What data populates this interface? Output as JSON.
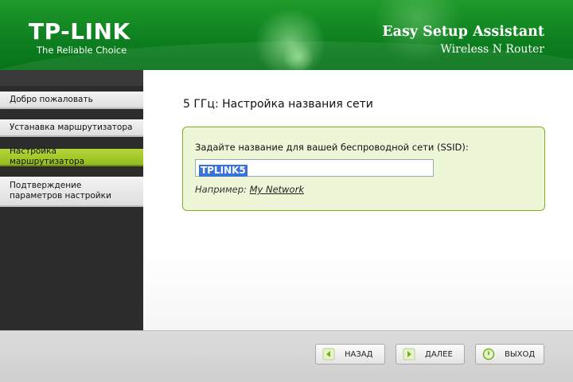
{
  "header": {
    "logo": "TP-LINK",
    "tagline": "The Reliable Choice",
    "title": "Easy Setup Assistant",
    "subtitle": "Wireless N Router"
  },
  "sidebar": {
    "items": [
      {
        "label": "Добро пожаловать",
        "active": false
      },
      {
        "label": "Устанавка маршрутизатора",
        "active": false
      },
      {
        "label": "Настройка маршрутизатора",
        "active": true
      },
      {
        "label": "Подтверждение параметров настройки",
        "active": false
      }
    ]
  },
  "main": {
    "title": "5 ГГц: Настройка названия сети",
    "ssid_label": "Задайте название для вашей беспроводной сети (SSID):",
    "ssid_value": "TPLINK5",
    "example_prefix": "Например:",
    "example_value": "My Network"
  },
  "footer": {
    "back_label": "НАЗАД",
    "next_label": "ДАЛЕЕ",
    "exit_label": "ВЫХОД"
  },
  "colors": {
    "header_green": "#0e8020",
    "active_nav": "#a6c92b",
    "panel_bg": "#edf7d8",
    "panel_border": "#7fb21f",
    "selection": "#3a73d8"
  },
  "icons": {
    "back": "arrow-left-icon",
    "next": "arrow-right-icon",
    "exit": "power-icon"
  }
}
